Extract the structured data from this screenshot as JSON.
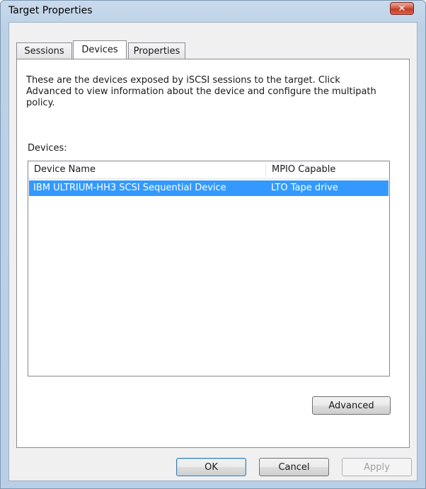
{
  "window": {
    "title": "Target Properties",
    "close_label": "✕"
  },
  "tabs": [
    {
      "label": "Sessions"
    },
    {
      "label": "Devices"
    },
    {
      "label": "Properties"
    }
  ],
  "devices_tab": {
    "description": "These are the devices exposed by iSCSI sessions to the target. Click Advanced to view information about the device and configure the multipath policy.",
    "devices_label": "Devices:",
    "columns": [
      "Device Name",
      "MPIO Capable"
    ],
    "rows": [
      {
        "device_name": "IBM ULTRIUM-HH3 SCSI Sequential Device",
        "mpio_capable": "LTO Tape drive",
        "selected": true
      }
    ],
    "advanced_label": "Advanced"
  },
  "footer": {
    "ok_label": "OK",
    "cancel_label": "Cancel",
    "apply_label": "Apply"
  },
  "colors": {
    "selection": "#3399ff",
    "close_button": "#c94a35",
    "window_frame": "#bcd0e6"
  }
}
